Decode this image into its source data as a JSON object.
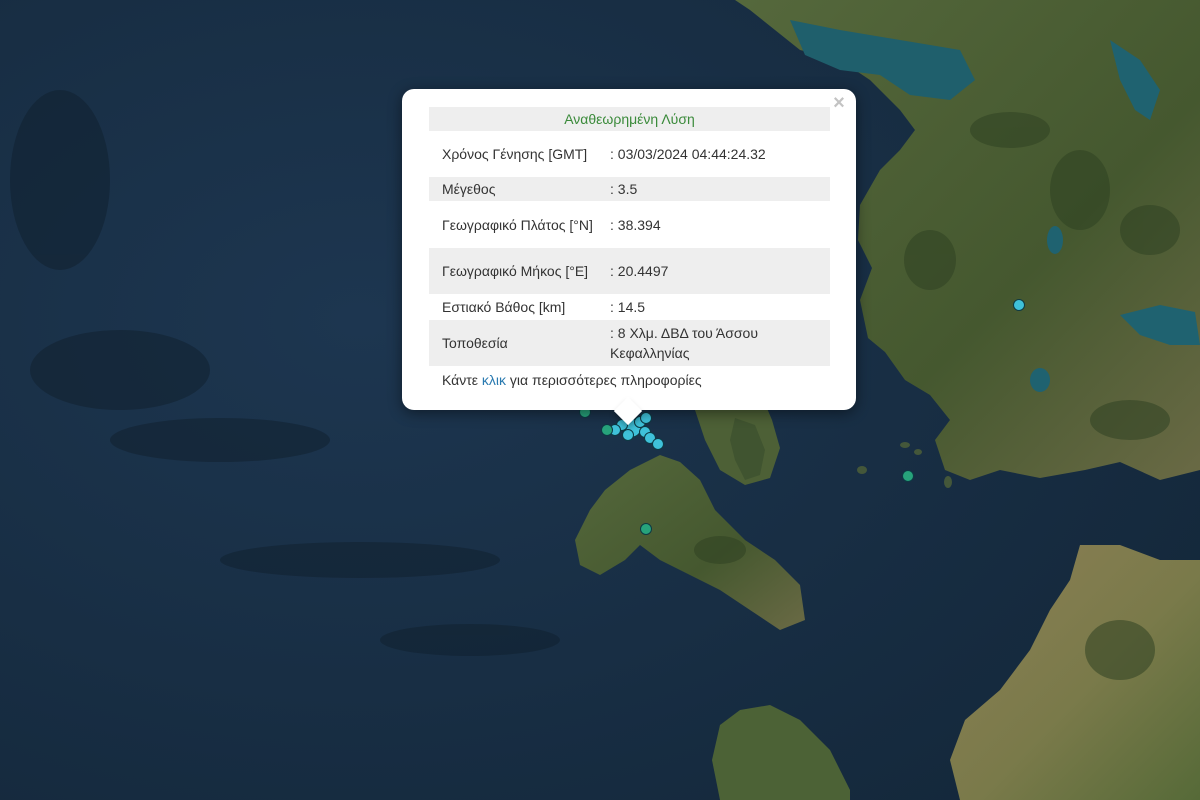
{
  "map": {
    "colors": {
      "sea": "#1a3046",
      "sea_dark": "#142638",
      "land": "#4b5d35",
      "land_dark": "#364a28",
      "land_light": "#8e8258",
      "lake": "#1f6270"
    },
    "earthquakes": [
      {
        "color": "#3fc1d9",
        "size": "large"
      },
      {
        "color": "#3fc1d9",
        "size": "small"
      },
      {
        "color": "#3fc1d9",
        "size": "small"
      },
      {
        "color": "#3fc1d9",
        "size": "small"
      },
      {
        "color": "#3fc1d9",
        "size": "small"
      },
      {
        "color": "#3fc1d9",
        "size": "small"
      },
      {
        "color": "#3fc1d9",
        "size": "small"
      },
      {
        "color": "#3fc1d9",
        "size": "small"
      },
      {
        "color": "#3fc1d9",
        "size": "small"
      },
      {
        "color": "#27a37b",
        "size": "small"
      },
      {
        "color": "#27a37b",
        "size": "small"
      },
      {
        "color": "#27a37b",
        "size": "small"
      },
      {
        "color": "#27a37b",
        "size": "small"
      },
      {
        "color": "#3fc1d9",
        "size": "small"
      }
    ]
  },
  "popup": {
    "close_symbol": "×",
    "header": "Αναθεωρημένη Λύση",
    "rows": [
      {
        "label": "Χρόνος Γένησης [GMT]",
        "value": ": 03/03/2024 04:44:24.32"
      },
      {
        "label": "Μέγεθος",
        "value": ": 3.5"
      },
      {
        "label": "Γεωγραφικό Πλάτος [°N]",
        "value": ": 38.394"
      },
      {
        "label": "Γεωγραφικό Μήκος [°E]",
        "value": ": 20.4497"
      },
      {
        "label": "Εστιακό Βάθος [km]",
        "value": ": 14.5"
      },
      {
        "label": "Τοποθεσία",
        "value": ": 8 Χλμ. ΔΒΔ του Άσσου Κεφαλληνίας"
      }
    ],
    "footer": {
      "prefix": "Κάντε ",
      "link": "κλικ",
      "suffix": " για περισσότερες πληροφορίες"
    }
  }
}
